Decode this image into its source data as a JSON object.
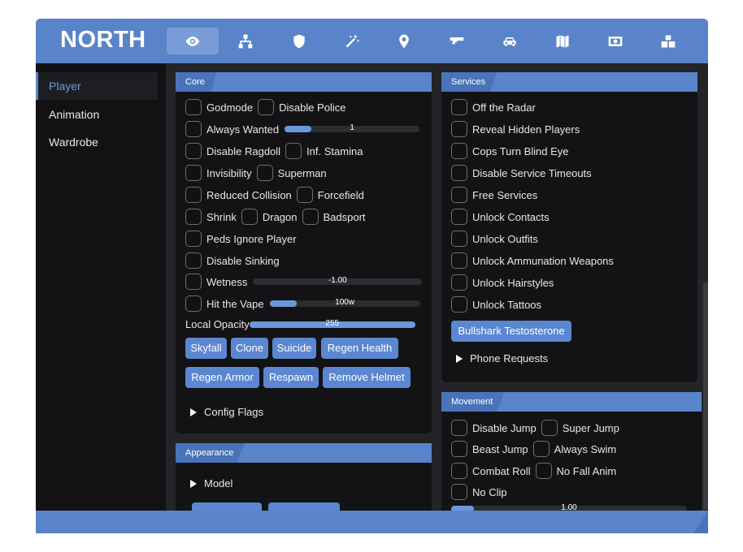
{
  "app": {
    "title": "NORTH"
  },
  "tabs": [
    {
      "name": "eye-icon",
      "active": true
    },
    {
      "name": "network-icon"
    },
    {
      "name": "shield-icon"
    },
    {
      "name": "magic-wand-icon"
    },
    {
      "name": "location-pin-icon"
    },
    {
      "name": "gun-icon"
    },
    {
      "name": "car-icon"
    },
    {
      "name": "map-icon"
    },
    {
      "name": "money-icon"
    },
    {
      "name": "boxes-icon"
    }
  ],
  "sidebar": {
    "items": [
      {
        "label": "Player",
        "active": true
      },
      {
        "label": "Animation"
      },
      {
        "label": "Wardrobe"
      }
    ]
  },
  "core": {
    "title": "Core",
    "godmode": "Godmode",
    "disable_police": "Disable Police",
    "always_wanted": "Always Wanted",
    "always_wanted_value": "1",
    "always_wanted_fraction": 0.2,
    "disable_ragdoll": "Disable Ragdoll",
    "inf_stamina": "Inf. Stamina",
    "invisibility": "Invisibility",
    "superman": "Superman",
    "reduced_collision": "Reduced Collision",
    "forcefield": "Forcefield",
    "shrink": "Shrink",
    "dragon": "Dragon",
    "badsport": "Badsport",
    "peds_ignore": "Peds Ignore Player",
    "disable_sinking": "Disable Sinking",
    "wetness": "Wetness",
    "wetness_value": "-1.00",
    "wetness_fraction": 0,
    "hit_vape": "Hit the Vape",
    "hit_vape_value": "100w",
    "hit_vape_fraction": 0.18,
    "local_opacity": "Local Opacity",
    "local_opacity_value": "255",
    "local_opacity_fraction": 1.0,
    "btn_skyfall": "Skyfall",
    "btn_clone": "Clone",
    "btn_suicide": "Suicide",
    "btn_regen_health": "Regen Health",
    "btn_regen_armor": "Regen Armor",
    "btn_respawn": "Respawn",
    "btn_remove_helmet": "Remove Helmet",
    "config_flags": "Config Flags"
  },
  "appearance": {
    "title": "Appearance",
    "model": "Model"
  },
  "services": {
    "title": "Services",
    "items": [
      "Off the Radar",
      "Reveal Hidden Players",
      "Cops Turn Blind Eye",
      "Disable Service Timeouts",
      "Free Services",
      "Unlock Contacts",
      "Unlock Outfits",
      "Unlock Ammunation Weapons",
      "Unlock Hairstyles",
      "Unlock Tattoos"
    ],
    "btn_bullshark": "Bullshark Testosterone",
    "phone_requests": "Phone Requests"
  },
  "movement": {
    "title": "Movement",
    "disable_jump": "Disable Jump",
    "super_jump": "Super Jump",
    "beast_jump": "Beast Jump",
    "always_swim": "Always Swim",
    "combat_roll": "Combat Roll",
    "no_fall_anim": "No Fall Anim",
    "no_clip": "No Clip",
    "slider_value": "1.00"
  }
}
